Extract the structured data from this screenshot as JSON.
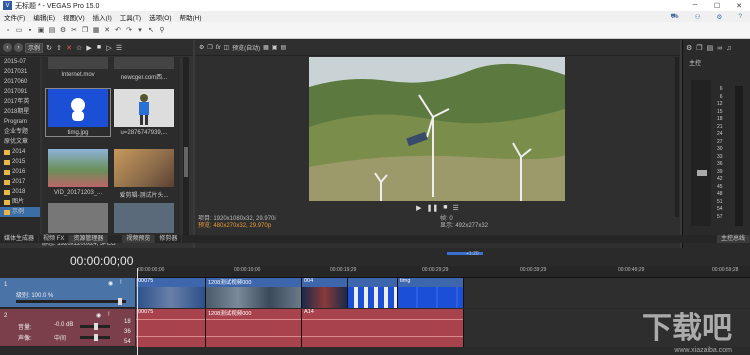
{
  "window": {
    "title": "无标题 * - VEGAS Pro 15.0",
    "app_icon": "V"
  },
  "menu": {
    "items": [
      "文件(F)",
      "编辑(E)",
      "视图(V)",
      "插入(I)",
      "工具(T)",
      "选项(O)",
      "帮助(H)"
    ]
  },
  "explorer": {
    "path_select": "示例",
    "tree": [
      "2015-07",
      "2017031",
      "2017060",
      "2017091",
      "2017年英",
      "2018期星",
      "Program",
      "企业专题",
      "原优文章",
      "2014",
      "2015",
      "2016",
      "2017",
      "2018",
      "图片",
      "示例"
    ],
    "items": [
      {
        "name": "Internet.mov"
      },
      {
        "name": "newcger.com西..."
      },
      {
        "name": "timg.jpg"
      },
      {
        "name": "u=2876747939,..."
      },
      {
        "name": "VID_20171203_..."
      },
      {
        "name": "爱剪辑-测试片头..."
      }
    ],
    "status": "静态: 1920x1200x24, JPEG"
  },
  "panel_tabs": [
    "媒体生成器",
    "视频 FX",
    "资源管理器",
    "视频预览",
    "修剪器"
  ],
  "preview": {
    "quality_select": "预览(自动)",
    "info_project": "项目: 1920x1080x32, 29.970i",
    "info_preview": "预览: 480x270x32, 29.970p",
    "info_frame_label": "帧:",
    "info_frame": "0",
    "info_display": "显示: 492x277x32"
  },
  "mixer": {
    "label": "主控",
    "tab": "主控总线",
    "scale": [
      "6",
      "-",
      "3",
      "-",
      "6",
      "-",
      "9",
      "-",
      "12",
      "-",
      "15",
      "-",
      "18",
      "-",
      "21",
      "-",
      "24",
      "-",
      "27",
      "-",
      "30",
      "-",
      "33",
      "-",
      "36",
      "-",
      "39",
      "-",
      "42",
      "-",
      "45",
      "-",
      "48",
      "-",
      "51",
      "-",
      "54",
      "-",
      "57"
    ]
  },
  "timeline": {
    "timecode": "00:00:00;00",
    "loop_label": "+1:20",
    "ruler": [
      "00:00:00;00",
      "00:00:10;00",
      "00:00:19;29",
      "00:00:29;29",
      "00:00:39;29",
      "00:00:49;29",
      "00:00:59;28"
    ],
    "track1": {
      "num": "1",
      "level": "级别: 100.0 %"
    },
    "track2": {
      "num": "2",
      "volume_label": "音量:",
      "volume": "-0.0 dB",
      "pan_label": "声像:",
      "pan": "中间",
      "scale_top": "18",
      "scale_mid": "36",
      "scale_bot": "54"
    },
    "video_clips": [
      "00075",
      "1208测试视频000",
      "004",
      "",
      "timg"
    ],
    "audio_clips": [
      "00075",
      "1208测试视频000",
      "A14"
    ]
  },
  "watermark": {
    "text": "下载吧",
    "site": "www.xiazaiba.com"
  }
}
